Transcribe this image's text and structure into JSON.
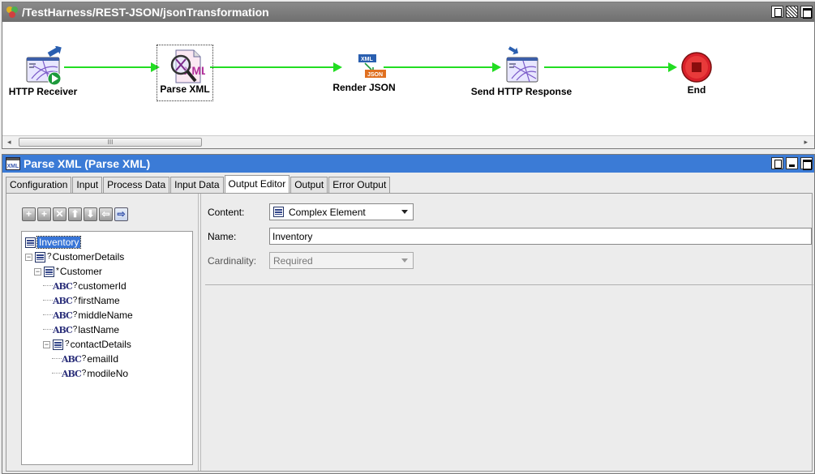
{
  "process_window": {
    "title": "/TestHarness/REST-JSON/jsonTransformation"
  },
  "nodes": [
    {
      "label": "HTTP Receiver"
    },
    {
      "label": "Parse XML"
    },
    {
      "label": "Render JSON",
      "badge_top": "XML",
      "badge_bottom": "JSON"
    },
    {
      "label": "Send HTTP Response"
    },
    {
      "label": "End"
    }
  ],
  "scroll": {
    "thumb_grip": "III",
    "left_arrow": "◂",
    "right_arrow": "▸"
  },
  "detail_window": {
    "title": "Parse XML (Parse XML)",
    "icon_text": "XML"
  },
  "tabs": [
    {
      "label": "Configuration",
      "active": false
    },
    {
      "label": "Input",
      "active": false
    },
    {
      "label": "Process Data",
      "active": false
    },
    {
      "label": "Input Data",
      "active": false
    },
    {
      "label": "Output Editor",
      "active": true
    },
    {
      "label": "Output",
      "active": false
    },
    {
      "label": "Error Output",
      "active": false
    }
  ],
  "toolbar": {
    "add": "+",
    "add_child": "+",
    "delete": "✕",
    "move_up": "⬆",
    "move_down": "⬇",
    "move_left": "⇦",
    "move_right": "⇨"
  },
  "tree": [
    {
      "label": "Inventory",
      "type": "complex",
      "card": "",
      "level": 0,
      "selected": true,
      "expander": ""
    },
    {
      "label": "CustomerDetails",
      "type": "complex",
      "card": "?",
      "level": 0,
      "selected": false,
      "expander": "−"
    },
    {
      "label": "Customer",
      "type": "complex",
      "card": "*",
      "level": 1,
      "selected": false,
      "expander": "−"
    },
    {
      "label": "customerId",
      "type": "string",
      "card": "?",
      "level": 2,
      "selected": false,
      "expander": ""
    },
    {
      "label": "firstName",
      "type": "string",
      "card": "?",
      "level": 2,
      "selected": false,
      "expander": ""
    },
    {
      "label": "middleName",
      "type": "string",
      "card": "?",
      "level": 2,
      "selected": false,
      "expander": ""
    },
    {
      "label": "lastName",
      "type": "string",
      "card": "?",
      "level": 2,
      "selected": false,
      "expander": ""
    },
    {
      "label": "contactDetails",
      "type": "complex",
      "card": "?",
      "level": 2,
      "selected": false,
      "expander": "−"
    },
    {
      "label": "emailId",
      "type": "string",
      "card": "?",
      "level": 3,
      "selected": false,
      "expander": ""
    },
    {
      "label": "modileNo",
      "type": "string",
      "card": "?",
      "level": 3,
      "selected": false,
      "expander": ""
    }
  ],
  "string_icon_text": "ABC",
  "form": {
    "content_label": "Content:",
    "content_value": "Complex Element",
    "name_label": "Name:",
    "name_value": "Inventory",
    "cardinality_label": "Cardinality:",
    "cardinality_value": "Required"
  },
  "colors": {
    "flow_line": "#22dd22",
    "detail_title_bg": "#3b7bd6",
    "selection": "#3875d7"
  }
}
